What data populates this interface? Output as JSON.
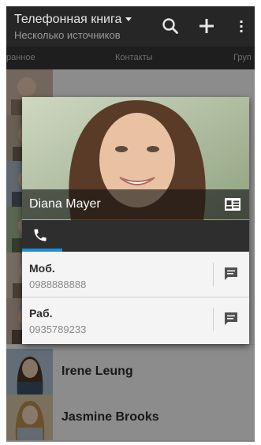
{
  "action_bar": {
    "title": "Телефонная книга",
    "subtitle": "Несколько источников",
    "icons": [
      "search-icon",
      "add-icon",
      "overflow-menu-icon"
    ]
  },
  "tabs": {
    "items": [
      "Избранное",
      "Контакты",
      "Группы"
    ],
    "visible_text": [
      "ранное",
      "Контакты",
      "Груп"
    ]
  },
  "contacts": [
    {
      "name": "Irene Leung",
      "photo": "contact-photo"
    },
    {
      "name": "Jasmine Brooks",
      "photo": "contact-photo"
    }
  ],
  "quick_contact": {
    "name": "Diana Mayer",
    "phones": [
      {
        "type": "Моб.",
        "number": "0988888888"
      },
      {
        "type": "Раб.",
        "number": "0935789233"
      }
    ],
    "icons": [
      "vcard-icon",
      "phone-icon",
      "message-icon"
    ]
  },
  "colors": {
    "action_bar": "#262626",
    "accent": "#1c8fd6",
    "card_background": "#f4f4f4"
  }
}
